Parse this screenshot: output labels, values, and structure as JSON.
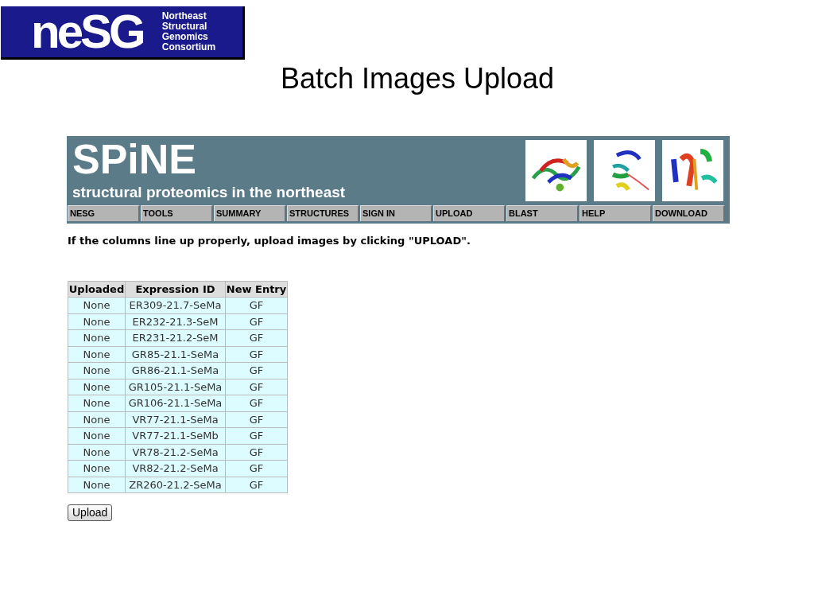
{
  "logo": {
    "wordmark": "neSG",
    "lines": [
      "Northeast",
      "Structural",
      "Genomics",
      "Consortium"
    ]
  },
  "slide_title": "Batch Images Upload",
  "banner": {
    "title": "SPiNE",
    "subtitle": "structural proteomics in the northeast"
  },
  "nav": [
    "NESG",
    "TOOLS",
    "SUMMARY",
    "STRUCTURES",
    "SIGN IN",
    "UPLOAD",
    "BLAST",
    "HELP",
    "DOWNLOAD"
  ],
  "instruction": "If the columns line up properly, upload images by clicking \"UPLOAD\".",
  "table": {
    "columns": [
      "Uploaded",
      "Expression ID",
      "New Entry"
    ],
    "rows": [
      [
        "None",
        "ER309-21.7-SeMa",
        "GF"
      ],
      [
        "None",
        "ER232-21.3-SeM",
        "GF"
      ],
      [
        "None",
        "ER231-21.2-SeM",
        "GF"
      ],
      [
        "None",
        "GR85-21.1-SeMa",
        "GF"
      ],
      [
        "None",
        "GR86-21.1-SeMa",
        "GF"
      ],
      [
        "None",
        "GR105-21.1-SeMa",
        "GF"
      ],
      [
        "None",
        "GR106-21.1-SeMa",
        "GF"
      ],
      [
        "None",
        "VR77-21.1-SeMa",
        "GF"
      ],
      [
        "None",
        "VR77-21.1-SeMb",
        "GF"
      ],
      [
        "None",
        "VR78-21.2-SeMa",
        "GF"
      ],
      [
        "None",
        "VR82-21.2-SeMa",
        "GF"
      ],
      [
        "None",
        "ZR260-21.2-SeMa",
        "GF"
      ]
    ]
  },
  "button": "Upload"
}
